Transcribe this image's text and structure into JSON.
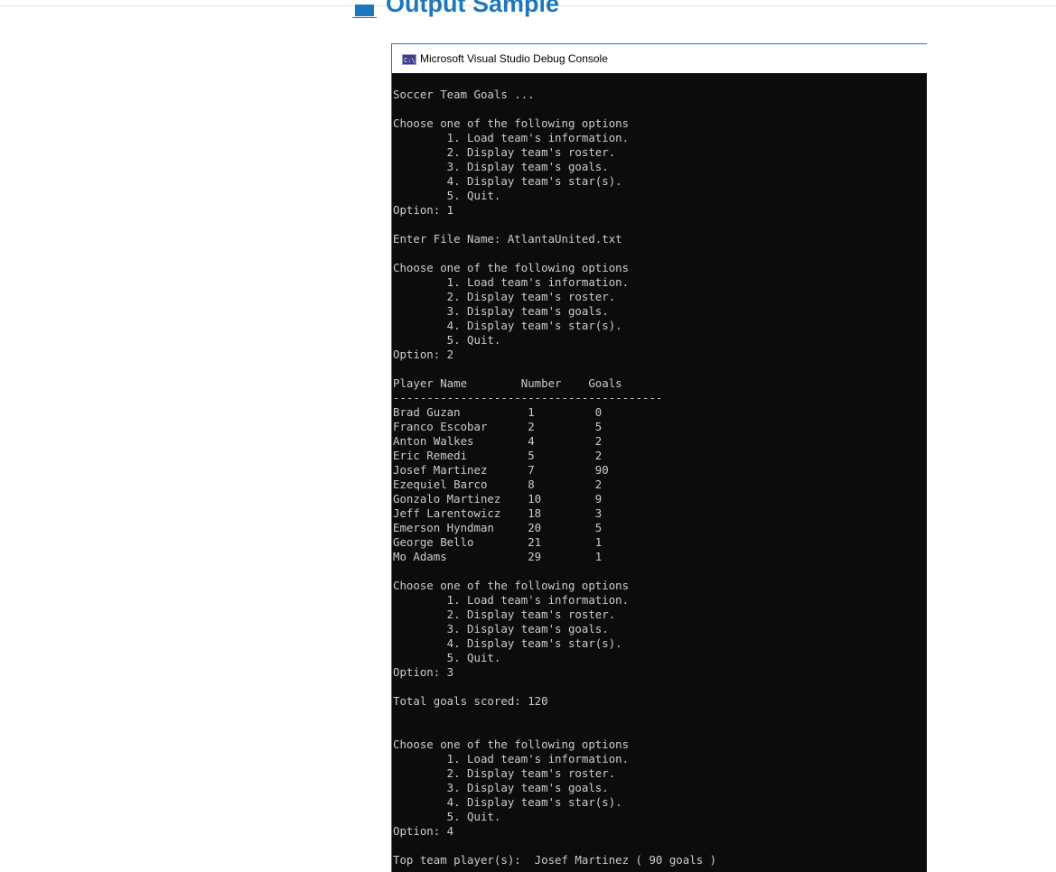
{
  "page": {
    "section_title": "Output Sample",
    "section_icon": "laptop-icon"
  },
  "window": {
    "title": "Microsoft Visual Studio Debug Console",
    "icon": "console-app-icon"
  },
  "console_lines": [
    "Soccer Team Goals ...",
    "",
    "Choose one of the following options",
    "        1. Load team's information.",
    "        2. Display team's roster.",
    "        3. Display team's goals.",
    "        4. Display team's star(s).",
    "        5. Quit.",
    "Option: 1",
    "",
    "Enter File Name: AtlantaUnited.txt",
    "",
    "Choose one of the following options",
    "        1. Load team's information.",
    "        2. Display team's roster.",
    "        3. Display team's goals.",
    "        4. Display team's star(s).",
    "        5. Quit.",
    "Option: 2",
    "",
    "Player Name        Number    Goals",
    "----------------------------------------",
    "Brad Guzan          1         0",
    "Franco Escobar      2         5",
    "Anton Walkes        4         2",
    "Eric Remedi         5         2",
    "Josef Martinez      7         90",
    "Ezequiel Barco      8         2",
    "Gonzalo Martinez    10        9",
    "Jeff Larentowicz    18        3",
    "Emerson Hyndman     20        5",
    "George Bello        21        1",
    "Mo Adams            29        1",
    "",
    "Choose one of the following options",
    "        1. Load team's information.",
    "        2. Display team's roster.",
    "        3. Display team's goals.",
    "        4. Display team's star(s).",
    "        5. Quit.",
    "Option: 3",
    "",
    "Total goals scored: 120",
    "",
    "",
    "Choose one of the following options",
    "        1. Load team's information.",
    "        2. Display team's roster.",
    "        3. Display team's goals.",
    "        4. Display team's star(s).",
    "        5. Quit.",
    "Option: 4",
    "",
    "Top team player(s):  Josef Martinez ( 90 goals )"
  ],
  "colors": {
    "heading": "#1d77bd",
    "console_bg": "#0c0c0c",
    "console_text": "#cccccc",
    "window_border": "#1979ca"
  }
}
